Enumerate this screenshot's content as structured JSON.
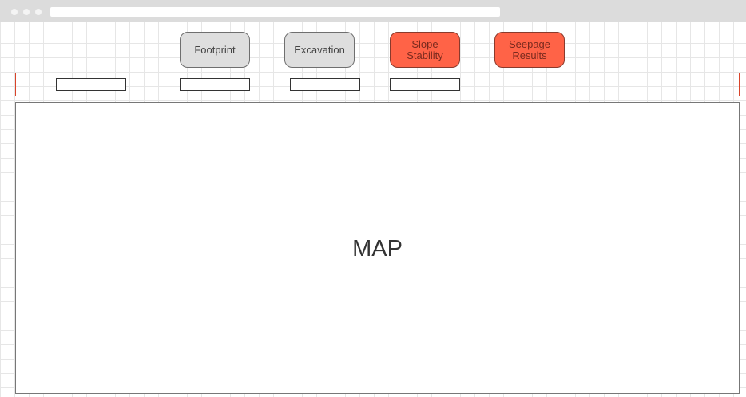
{
  "browser": {
    "window_buttons": [
      "close",
      "minimize",
      "maximize"
    ],
    "address": ""
  },
  "nav": {
    "footprint_label": "Footprint",
    "excavation_label": "Excavation",
    "slope_stability_label": "Slope\nStability",
    "seepage_results_label": "Seepage\nResults"
  },
  "fields": [
    {
      "value": ""
    },
    {
      "value": ""
    },
    {
      "value": ""
    },
    {
      "value": ""
    }
  ],
  "map": {
    "label": "MAP"
  },
  "colors": {
    "active_button": "#ff6347",
    "inactive_button": "#dedede",
    "strip_border": "#d9442a"
  }
}
